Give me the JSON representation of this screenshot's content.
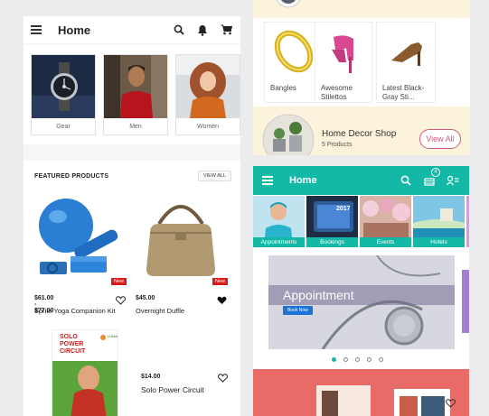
{
  "left": {
    "title": "Home",
    "categories": [
      {
        "label": "Gear"
      },
      {
        "label": "Men"
      },
      {
        "label": "Women"
      }
    ],
    "featured": {
      "heading": "FEATURED PRODUCTS",
      "view_all": "VIEW ALL",
      "products": [
        {
          "price": "$61.00 - $77.00",
          "name": "Sprite Yoga Companion Kit",
          "tag": "New"
        },
        {
          "price": "$45.00",
          "name": "Overnight Duffle",
          "tag": "New"
        },
        {
          "price": "$14.00",
          "name": "Solo Power Circuit",
          "cover_line1": "SOLO",
          "cover_line2": "POWER",
          "cover_line3": "CIRCUIT",
          "cover_brand": "LUMA"
        }
      ]
    }
  },
  "rtop": {
    "items": [
      {
        "caption": "Bangles"
      },
      {
        "caption": "Awesome Stilettos"
      },
      {
        "caption": "Latest Black-Gray Sti..."
      }
    ],
    "shop_name": "Home Decor Shop",
    "shop_count": "5 Products",
    "view_all": "View All"
  },
  "rbot": {
    "title": "Home",
    "cart_count": "4",
    "tiles": [
      {
        "label": "Appointments"
      },
      {
        "label": "Bookings",
        "screen_text": "2017"
      },
      {
        "label": "Events"
      },
      {
        "label": "Hotels"
      }
    ],
    "hero": {
      "title": "Appointment",
      "button": "Book Now"
    },
    "carousel_pages": 5,
    "carousel_active": 1
  },
  "colors": {
    "teal": "#14b8a6",
    "new_red": "#d91c1c",
    "pink": "#d05a7b",
    "cream": "#fcf3dc",
    "coral": "#e96b67"
  }
}
